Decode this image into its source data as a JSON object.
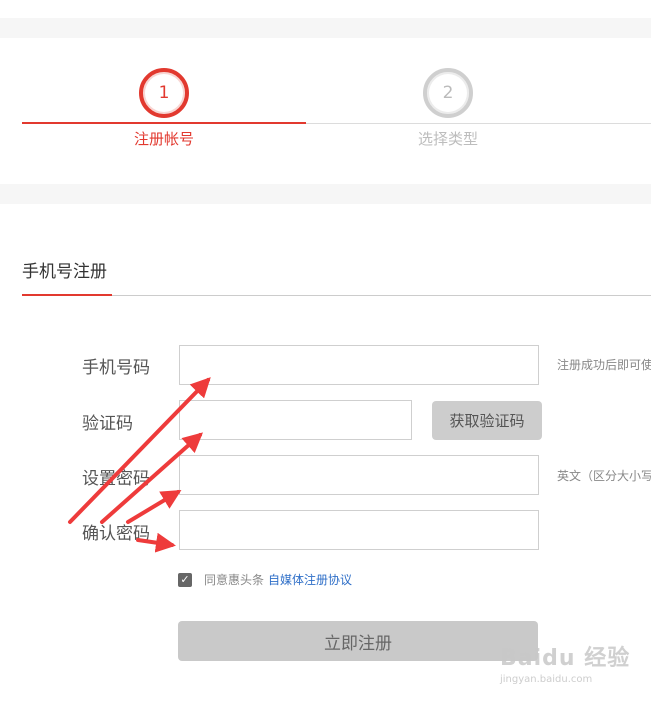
{
  "steps": [
    {
      "number": "1",
      "label": "注册帐号",
      "state": "active"
    },
    {
      "number": "2",
      "label": "选择类型",
      "state": "inactive"
    }
  ],
  "section": {
    "title": "手机号注册"
  },
  "form": {
    "phone": {
      "label": "手机号码",
      "value": "",
      "hint": "注册成功后即可使"
    },
    "code": {
      "label": "验证码",
      "value": "",
      "button": "获取验证码"
    },
    "password": {
      "label": "设置密码",
      "value": "",
      "hint": "英文（区分大小写"
    },
    "confirm": {
      "label": "确认密码",
      "value": ""
    },
    "agree": {
      "checked": true,
      "text": "同意惠头条",
      "link": "自媒体注册协议"
    },
    "submit": "立即注册"
  },
  "watermark": {
    "brand": "Baidu 经验",
    "url": "jingyan.baidu.com"
  },
  "colors": {
    "accent": "#e2392f",
    "arrow": "#ee3b3b",
    "link": "#2f6fc8",
    "button_disabled": "#c9c9c9"
  },
  "icons": {
    "checkbox": "checkbox-checked-icon",
    "arrows": "red-annotation-arrow-icon"
  }
}
